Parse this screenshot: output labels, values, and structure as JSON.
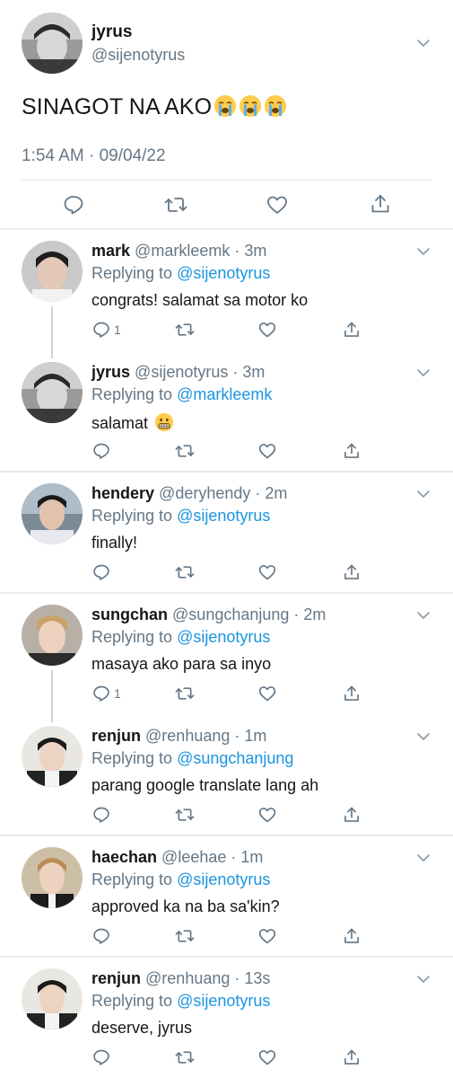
{
  "main_tweet": {
    "name": "jyrus",
    "handle": "@sijenotyrus",
    "text": "SINAGOT NA AKO",
    "emojis": [
      "loudly-crying-face",
      "loudly-crying-face",
      "loudly-crying-face"
    ],
    "timestamp": "1:54 AM · 09/04/22"
  },
  "replies": [
    {
      "name": "mark",
      "handle": "@markleemk",
      "time": "3m",
      "replying_label": "Replying to",
      "replying_to": "@sijenotyrus",
      "text": "congrats! salamat sa motor ko",
      "reply_count": "1"
    },
    {
      "name": "jyrus",
      "handle": "@sijenotyrus",
      "time": "3m",
      "replying_label": "Replying to",
      "replying_to": "@markleemk",
      "text": "salamat",
      "emoji": "grimacing-face",
      "reply_count": ""
    },
    {
      "name": "hendery",
      "handle": "@deryhendy",
      "time": "2m",
      "replying_label": "Replying to",
      "replying_to": "@sijenotyrus",
      "text": "finally!",
      "reply_count": ""
    },
    {
      "name": "sungchan",
      "handle": "@sungchanjung",
      "time": "2m",
      "replying_label": "Replying to",
      "replying_to": "@sijenotyrus",
      "text": "masaya ako para sa inyo",
      "reply_count": "1"
    },
    {
      "name": "renjun",
      "handle": "@renhuang",
      "time": "1m",
      "replying_label": "Replying to",
      "replying_to": "@sungchanjung",
      "text": "parang google translate lang ah",
      "reply_count": ""
    },
    {
      "name": "haechan",
      "handle": "@leehae",
      "time": "1m",
      "replying_label": "Replying to",
      "replying_to": "@sijenotyrus",
      "text": "approved ka na ba sa'kin?",
      "reply_count": ""
    },
    {
      "name": "renjun",
      "handle": "@renhuang",
      "time": "13s",
      "replying_label": "Replying to",
      "replying_to": "@sijenotyrus",
      "text": "deserve, jyrus",
      "reply_count": ""
    }
  ],
  "colors": {
    "link": "#1b95e0",
    "secondary_text": "#657786",
    "divider": "#e1e8ed",
    "thread_line": "#ccd6dd"
  }
}
